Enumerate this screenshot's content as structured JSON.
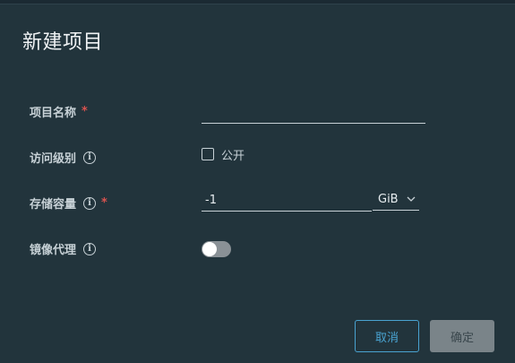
{
  "dialog": {
    "title": "新建项目",
    "fields": {
      "name": {
        "label": "项目名称",
        "required_mark": "*",
        "value": ""
      },
      "access": {
        "label": "访问级别",
        "info_glyph": "i",
        "checkbox_label": "公开",
        "checked": false
      },
      "storage": {
        "label": "存储容量",
        "info_glyph": "i",
        "required_mark": "*",
        "value": "-1",
        "unit": "GiB",
        "unit_chevron": "chevron-down-icon"
      },
      "proxy": {
        "label": "镜像代理",
        "info_glyph": "i",
        "enabled": false
      }
    },
    "buttons": {
      "cancel": "取消",
      "ok": "确定"
    }
  },
  "colors": {
    "accent": "#49a3d1",
    "required": "#d9534f",
    "background": "#22343c"
  }
}
